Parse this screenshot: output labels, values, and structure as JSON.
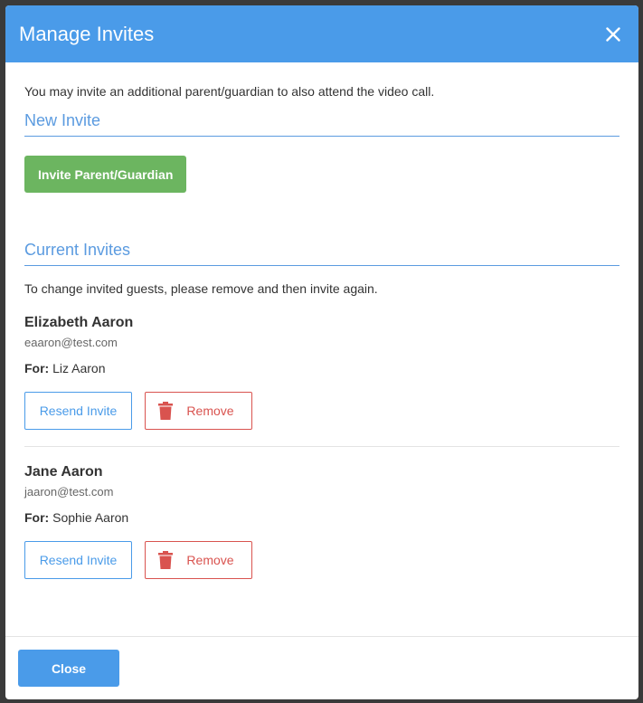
{
  "modal": {
    "title": "Manage Invites",
    "close_icon": "close-icon"
  },
  "intro_text": "You may invite an additional parent/guardian to also attend the video call.",
  "new_invite": {
    "heading": "New Invite",
    "invite_button_label": "Invite Parent/Guardian"
  },
  "current_invites": {
    "heading": "Current Invites",
    "helper_text": "To change invited guests, please remove and then invite again.",
    "items": [
      {
        "name": "Elizabeth Aaron",
        "email": "eaaron@test.com",
        "for_label": "For:",
        "for_value": "Liz Aaron",
        "resend_label": "Resend Invite",
        "remove_label": "Remove"
      },
      {
        "name": "Jane Aaron",
        "email": "jaaron@test.com",
        "for_label": "For:",
        "for_value": "Sophie Aaron",
        "resend_label": "Resend Invite",
        "remove_label": "Remove"
      }
    ]
  },
  "footer": {
    "close_label": "Close"
  },
  "colors": {
    "header": "#4a9be9",
    "accent": "#5b9be0",
    "success": "#6cb560",
    "danger": "#d9534f"
  }
}
